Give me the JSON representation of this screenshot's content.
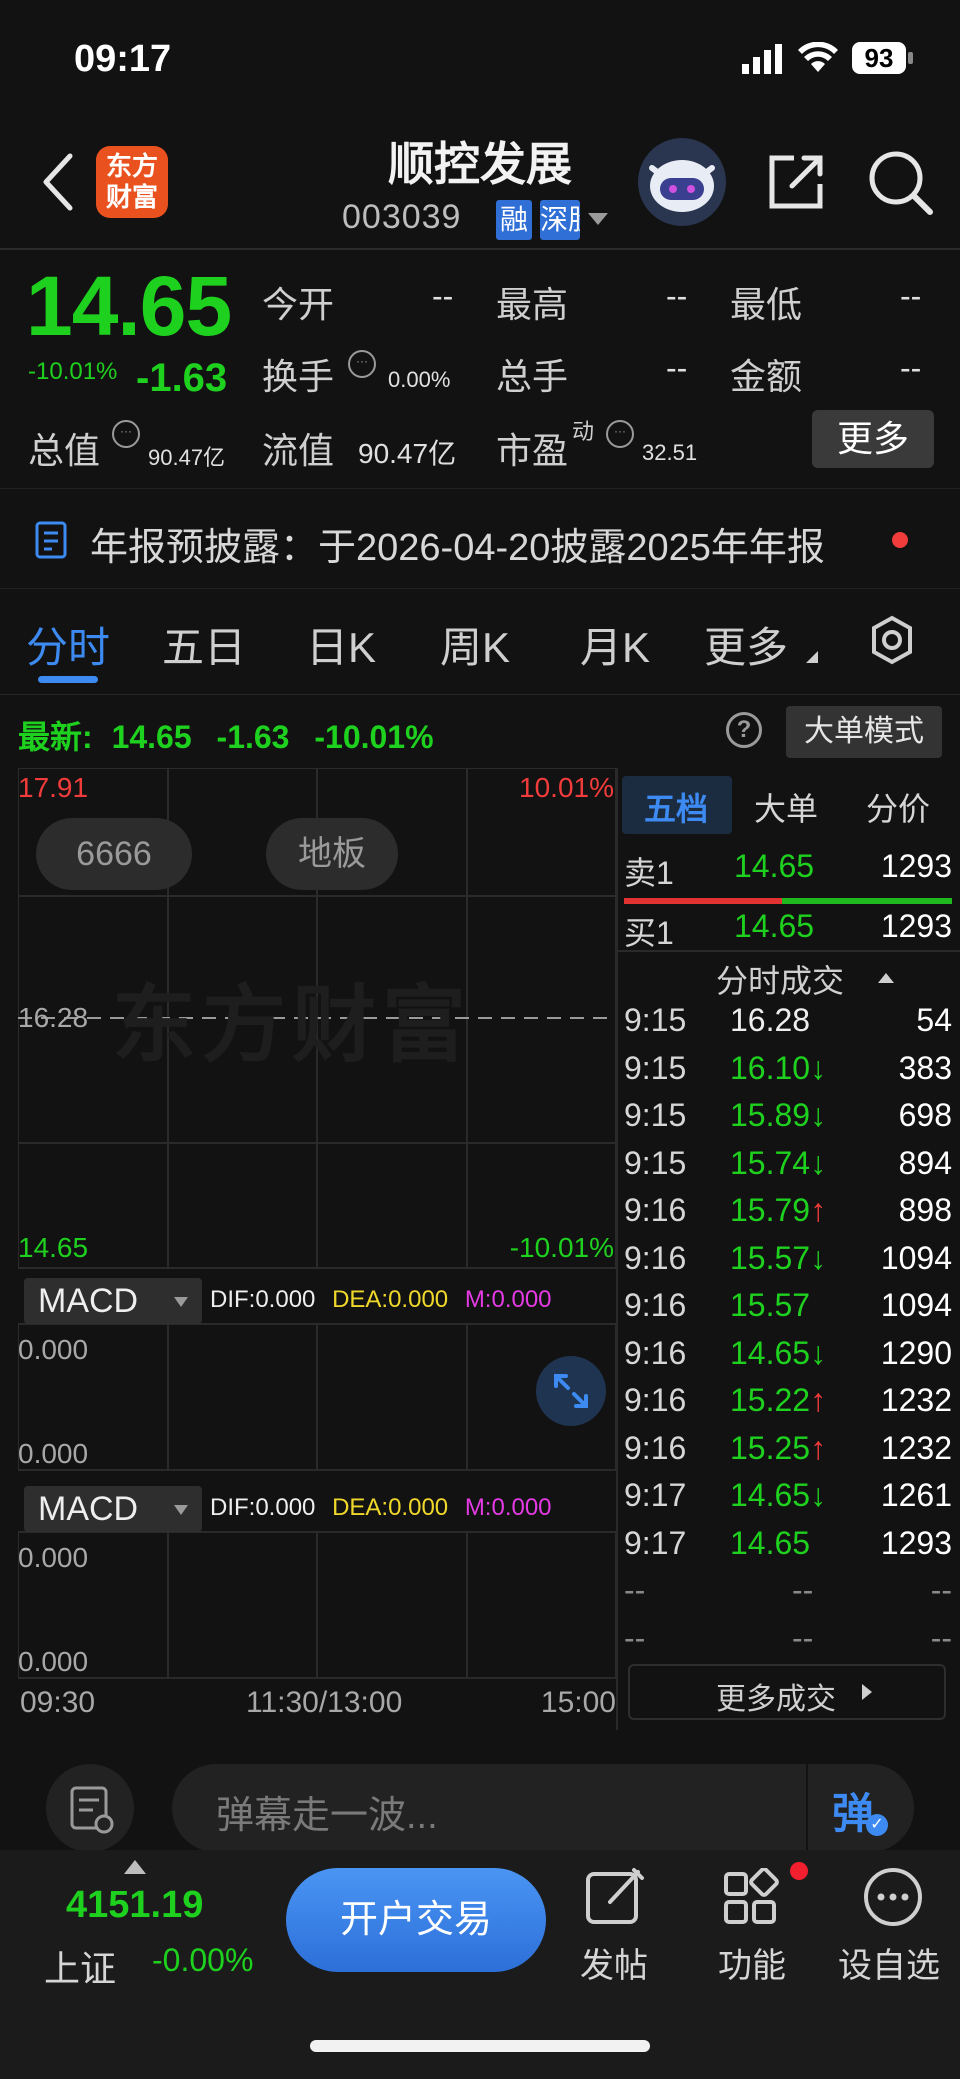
{
  "status_bar": {
    "time": "09:17",
    "battery": "93"
  },
  "header": {
    "logo_text": [
      "东方",
      "财富"
    ],
    "stock_name": "顺控发展",
    "stock_code": "003039",
    "tags": [
      "融",
      "深股"
    ]
  },
  "quote": {
    "price": "14.65",
    "change_pct": "-10.01%",
    "change": "-1.63",
    "open_label": "今开",
    "open_value": "--",
    "high_label": "最高",
    "high_value": "--",
    "low_label": "最低",
    "low_value": "--",
    "turnover_label": "换手",
    "turnover_value": "0.00%",
    "volume_label": "总手",
    "volume_value": "--",
    "amount_label": "金额",
    "amount_value": "--",
    "mktcap_label": "总值",
    "mktcap_value": "90.47亿",
    "float_label": "流值",
    "float_value": "90.47亿",
    "pe_label": "市盈",
    "pe_superscript": "动",
    "pe_value": "32.51",
    "more_label": "更多"
  },
  "notice": {
    "text": "年报预披露：于2026-04-20披露2025年年报"
  },
  "tabs": [
    {
      "label": "分时",
      "active": true
    },
    {
      "label": "五日",
      "active": false
    },
    {
      "label": "日K",
      "active": false
    },
    {
      "label": "周K",
      "active": false
    },
    {
      "label": "月K",
      "active": false
    },
    {
      "label": "更多",
      "active": false
    }
  ],
  "chart": {
    "latest_label": "最新:",
    "latest_price": "14.65",
    "latest_change": "-1.63",
    "latest_pct": "-10.01%",
    "mode_button": "大单模式",
    "y_top": "17.91",
    "y_top_pct": "10.01%",
    "y_mid": "16.28",
    "y_bottom": "14.65",
    "y_bottom_pct": "-10.01%",
    "badges": [
      "6666",
      "地板"
    ],
    "watermark": "东方财富",
    "indicators": [
      {
        "name": "MACD",
        "dif": "DIF:0.000",
        "dea": "DEA:0.000",
        "m": "M:0.000",
        "y_top": "0.000",
        "y_bottom": "0.000"
      },
      {
        "name": "MACD",
        "dif": "DIF:0.000",
        "dea": "DEA:0.000",
        "m": "M:0.000",
        "y_top": "0.000",
        "y_bottom": "0.000"
      }
    ],
    "x_labels": [
      "09:30",
      "11:30/13:00",
      "15:00"
    ]
  },
  "order_panel": {
    "tabs": [
      {
        "label": "五档",
        "active": true
      },
      {
        "label": "大单",
        "active": false
      },
      {
        "label": "分价",
        "active": false
      }
    ],
    "sell1": {
      "label": "卖1",
      "price": "14.65",
      "volume": "1293"
    },
    "buy1": {
      "label": "买1",
      "price": "14.65",
      "volume": "1293"
    },
    "trades_title": "分时成交",
    "trades": [
      {
        "time": "9:15",
        "price": "16.28",
        "dir": "",
        "volume": "54",
        "color": "#eeeeee"
      },
      {
        "time": "9:15",
        "price": "16.10",
        "dir": "↓",
        "volume": "383",
        "color": "#1fd11f"
      },
      {
        "time": "9:15",
        "price": "15.89",
        "dir": "↓",
        "volume": "698",
        "color": "#1fd11f"
      },
      {
        "time": "9:15",
        "price": "15.74",
        "dir": "↓",
        "volume": "894",
        "color": "#1fd11f"
      },
      {
        "time": "9:16",
        "price": "15.79",
        "dir": "↑",
        "volume": "898",
        "color": "#1fd11f"
      },
      {
        "time": "9:16",
        "price": "15.57",
        "dir": "↓",
        "volume": "1094",
        "color": "#1fd11f"
      },
      {
        "time": "9:16",
        "price": "15.57",
        "dir": "",
        "volume": "1094",
        "color": "#1fd11f"
      },
      {
        "time": "9:16",
        "price": "14.65",
        "dir": "↓",
        "volume": "1290",
        "color": "#1fd11f"
      },
      {
        "time": "9:16",
        "price": "15.22",
        "dir": "↑",
        "volume": "1232",
        "color": "#1fd11f"
      },
      {
        "time": "9:16",
        "price": "15.25",
        "dir": "↑",
        "volume": "1232",
        "color": "#1fd11f"
      },
      {
        "time": "9:17",
        "price": "14.65",
        "dir": "↓",
        "volume": "1261",
        "color": "#1fd11f"
      },
      {
        "time": "9:17",
        "price": "14.65",
        "dir": "",
        "volume": "1293",
        "color": "#1fd11f"
      },
      {
        "time": "--",
        "price": "--",
        "dir": "",
        "volume": "--",
        "color": "#8a8a8a"
      },
      {
        "time": "--",
        "price": "--",
        "dir": "",
        "volume": "--",
        "color": "#8a8a8a"
      }
    ],
    "more_trades": "更多成交"
  },
  "comment": {
    "placeholder": "弹幕走一波...",
    "send_label": "弹"
  },
  "bottom": {
    "index_value": "4151.19",
    "index_name": "上证",
    "index_pct": "-0.00%",
    "open_account": "开户交易",
    "actions": [
      "发帖",
      "功能",
      "设自选"
    ]
  },
  "colors": {
    "up": "#f23b3b",
    "down": "#1fd11f",
    "accent": "#3d8bf2",
    "background": "#121212"
  }
}
